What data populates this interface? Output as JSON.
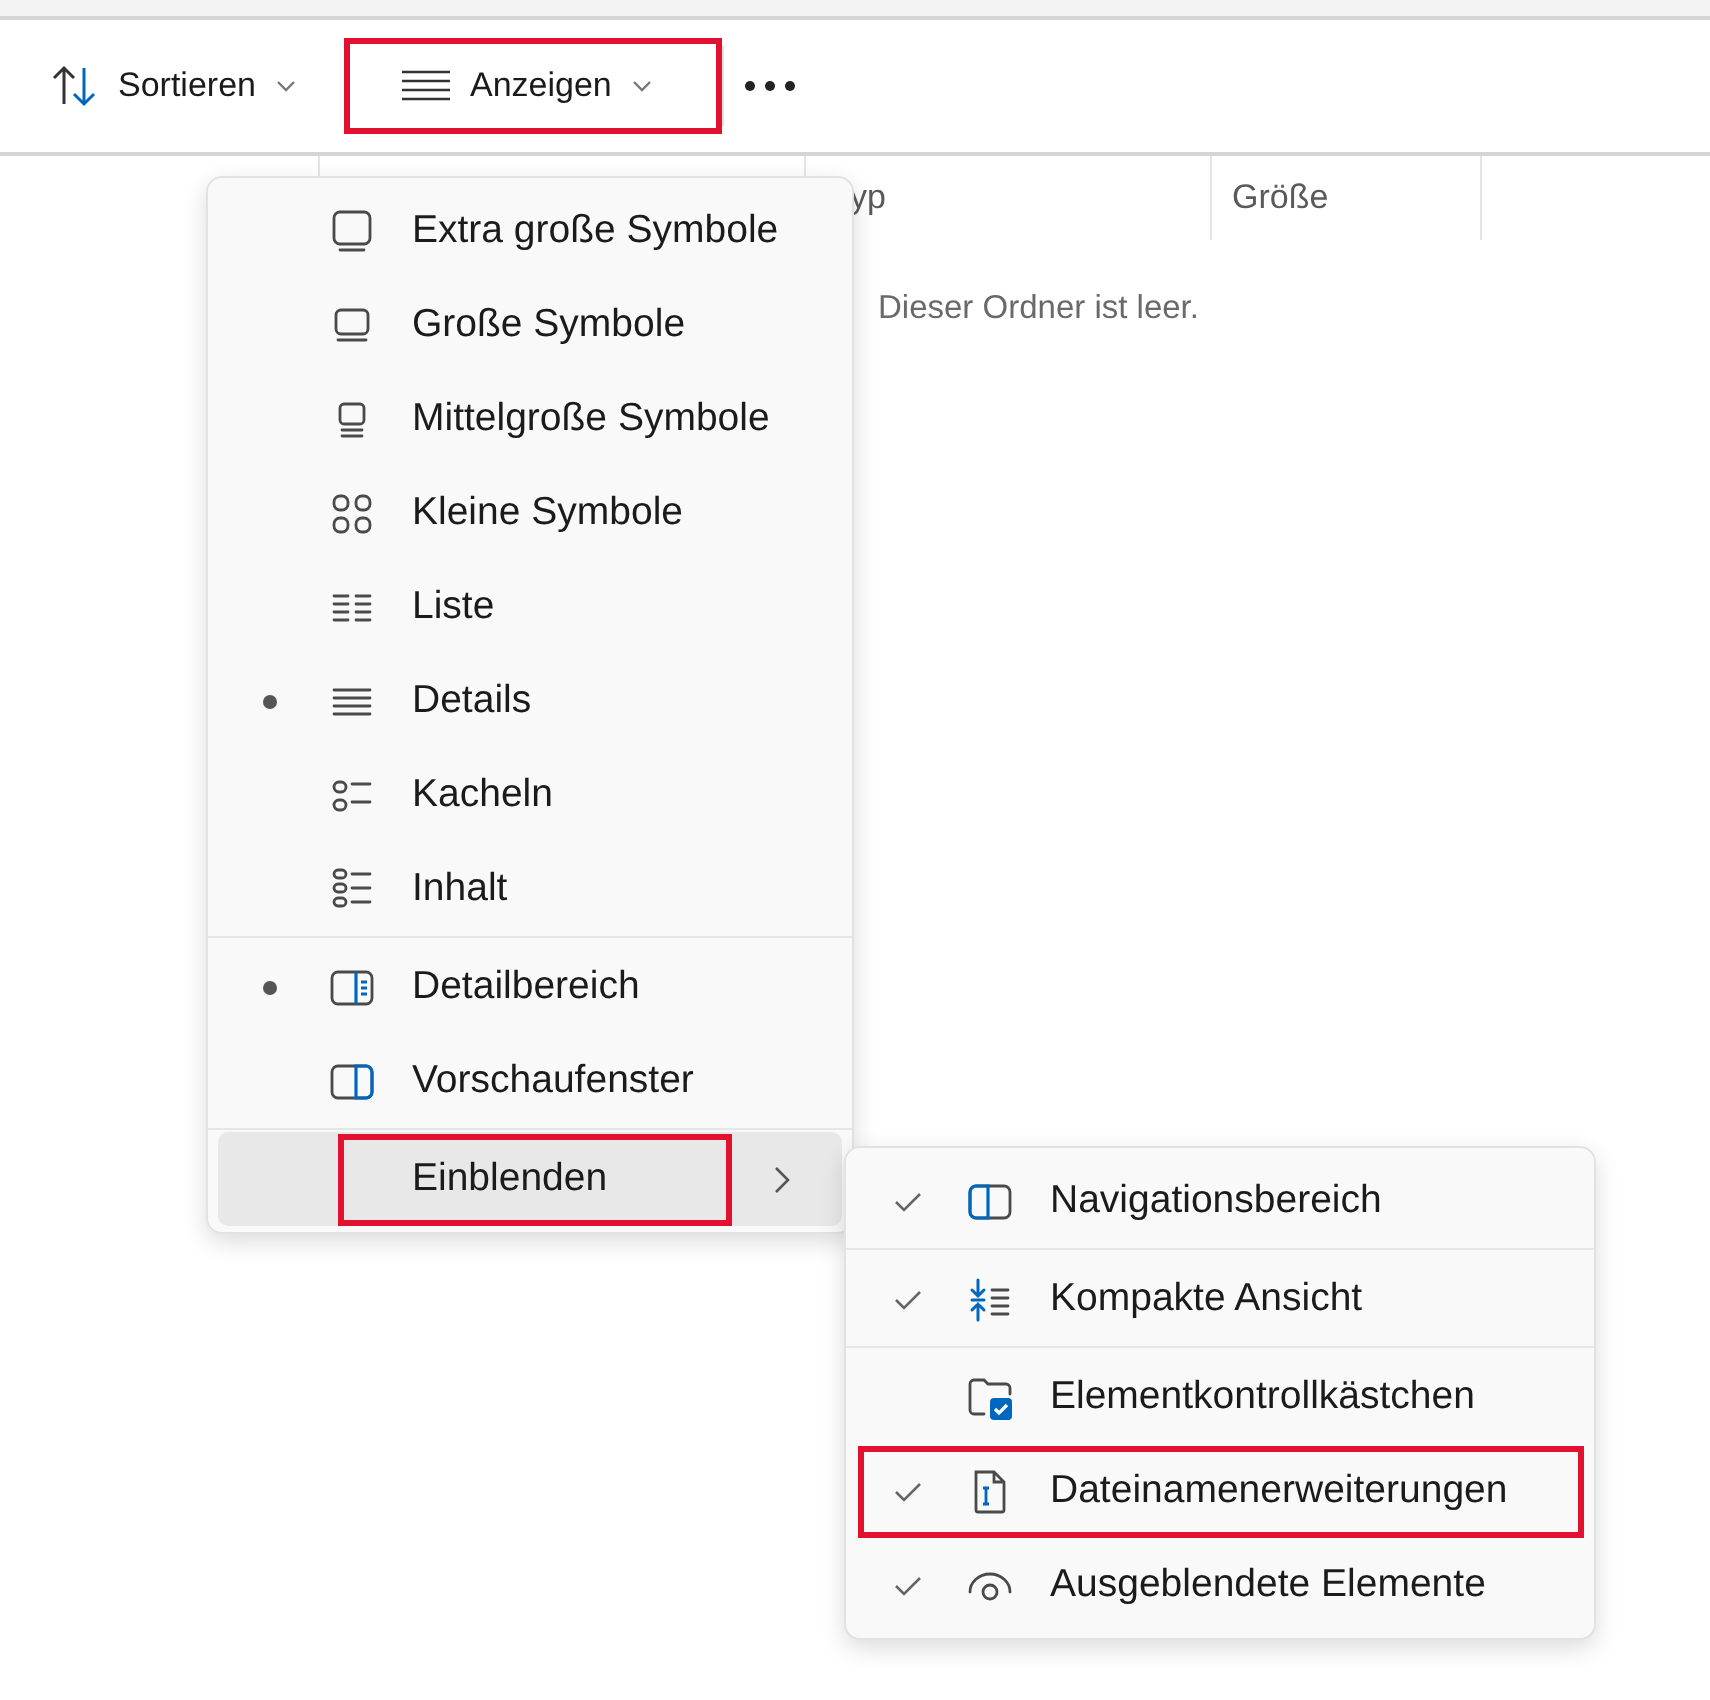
{
  "toolbar": {
    "buttons": [
      {
        "kind": "sort",
        "label": "Sortieren",
        "highlighted": false
      },
      {
        "kind": "view",
        "label": "Anzeigen",
        "highlighted": true
      }
    ]
  },
  "table": {
    "columns": [
      {},
      {},
      {
        "label": "yp"
      },
      {
        "label": "Größe"
      }
    ],
    "empty_message": "Dieser Ordner ist leer."
  },
  "view_menu": {
    "sections": [
      {
        "items": [
          {
            "kind": "option",
            "label": "Extra große Symbole",
            "selected": false
          },
          {
            "kind": "option",
            "label": "Große Symbole",
            "selected": false
          },
          {
            "kind": "option",
            "label": "Mittelgroße Symbole",
            "selected": false
          },
          {
            "kind": "option",
            "label": "Kleine Symbole",
            "selected": false
          },
          {
            "kind": "option",
            "label": "Liste",
            "selected": false
          },
          {
            "kind": "option",
            "label": "Details",
            "selected": true
          },
          {
            "kind": "option",
            "label": "Kacheln",
            "selected": false
          },
          {
            "kind": "option",
            "label": "Inhalt",
            "selected": false
          }
        ]
      },
      {
        "items": [
          {
            "kind": "option",
            "label": "Detailbereich",
            "selected": true
          },
          {
            "kind": "option",
            "label": "Vorschaufenster",
            "selected": false
          }
        ]
      },
      {
        "items": [
          {
            "kind": "submenu",
            "label": "Einblenden",
            "hovered": true,
            "highlighted": true
          }
        ]
      }
    ]
  },
  "show_menu": {
    "sections": [
      {
        "items": [
          {
            "label": "Navigationsbereich",
            "checked": true,
            "highlighted": false
          }
        ]
      },
      {
        "items": [
          {
            "label": "Kompakte Ansicht",
            "checked": true,
            "highlighted": false
          }
        ]
      },
      {
        "items": [
          {
            "label": "Elementkontrollkästchen",
            "checked": false,
            "highlighted": false
          },
          {
            "label": "Dateinamenerweiterungen",
            "checked": true,
            "highlighted": true
          },
          {
            "label": "Ausgeblendete Elemente",
            "checked": true,
            "highlighted": false
          }
        ]
      }
    ]
  }
}
